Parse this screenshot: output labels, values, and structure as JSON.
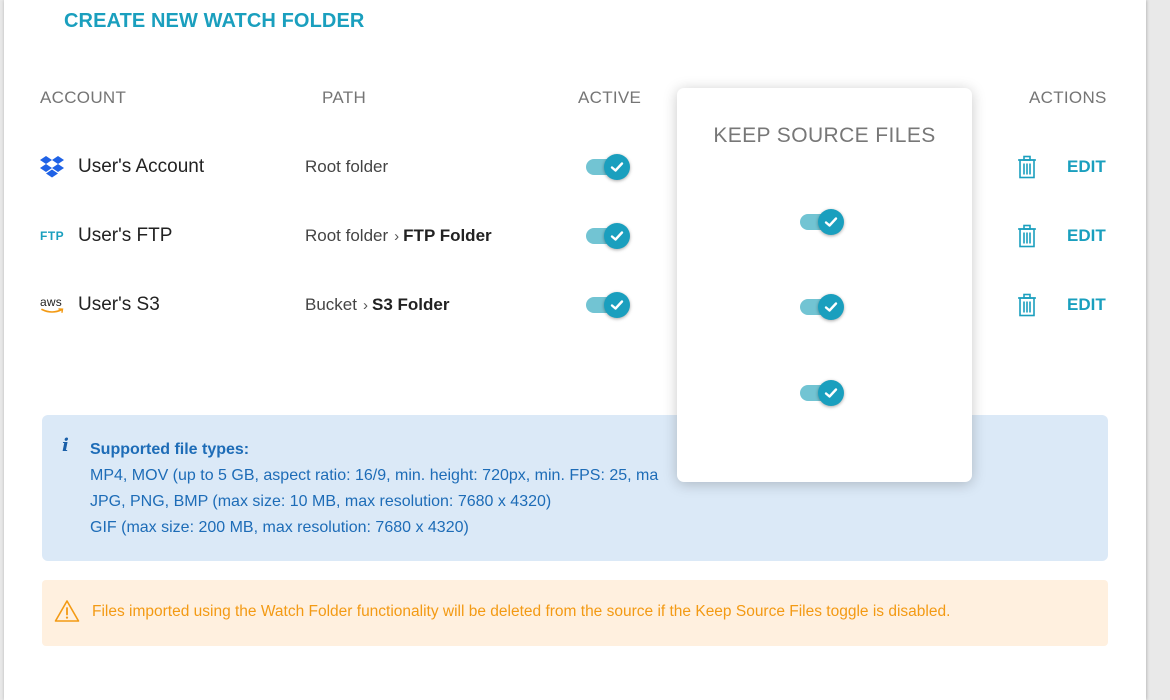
{
  "create_link": "CREATE NEW WATCH FOLDER",
  "table": {
    "headers": {
      "account": "ACCOUNT",
      "path": "PATH",
      "active": "ACTIVE",
      "actions": "ACTIONS"
    },
    "rows": [
      {
        "icon": "dropbox-icon",
        "account": "User's Account",
        "path_root": "Root folder",
        "path_folder": "",
        "active": true,
        "edit": "EDIT"
      },
      {
        "icon": "ftp-icon",
        "icon_text": "FTP",
        "account": "User's FTP",
        "path_root": "Root folder",
        "path_folder": "FTP Folder",
        "active": true,
        "edit": "EDIT"
      },
      {
        "icon": "aws-icon",
        "icon_text": "aws",
        "account": "User's S3",
        "path_root": "Bucket",
        "path_folder": "S3 Folder",
        "active": true,
        "edit": "EDIT"
      }
    ]
  },
  "popover": {
    "title": "KEEP SOURCE FILES",
    "toggles": [
      true,
      true,
      true
    ]
  },
  "info": {
    "title": "Supported file types:",
    "lines": [
      "MP4, MOV (up to 5 GB, aspect ratio: 16/9, min. height: 720px, min. FPS: 25, ma",
      "JPG, PNG, BMP (max size: 10 MB, max resolution: 7680 x 4320)",
      "GIF (max size: 200 MB, max resolution: 7680 x 4320)"
    ]
  },
  "warning": {
    "text": "Files imported using the Watch Folder functionality will be deleted from the source if the Keep Source Files toggle is disabled."
  },
  "colors": {
    "accent": "#1a9fbe",
    "info_bg": "#dbe9f7",
    "info_text": "#1d6cb7",
    "warning_bg": "#fff0df",
    "warning_text": "#f39a14"
  }
}
